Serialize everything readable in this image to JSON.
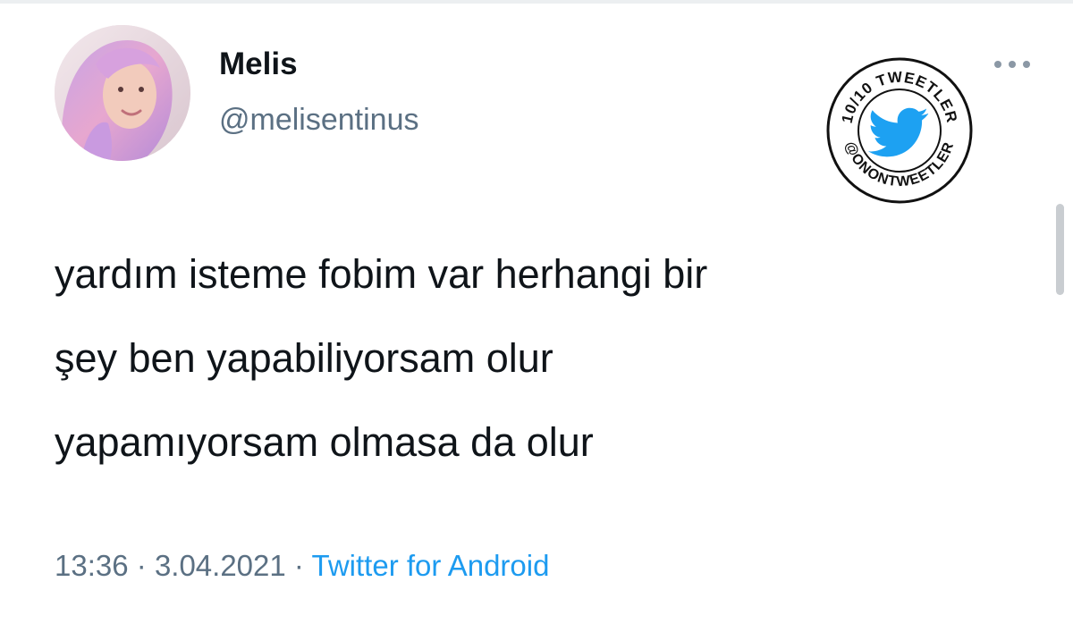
{
  "tweet": {
    "author": {
      "display_name": "Melis",
      "handle": "@melisentinus"
    },
    "text_lines": [
      "yardım isteme fobim var herhangi bir",
      "şey ben yapabiliyorsam olur",
      "yapamıyorsam olmasa da olur"
    ],
    "time": "13:36",
    "separator": "·",
    "date": "3.04.2021",
    "source": "Twitter for Android"
  },
  "watermark": {
    "text_top": "10/10 TWEETLER",
    "text_bottom": "@ONONTWEETLER",
    "bird_color": "#1da1f2"
  },
  "icons": {
    "more": "more-horizontal-icon",
    "avatar": "profile-photo"
  },
  "colors": {
    "name": "#0f1419",
    "secondary": "#5b7083",
    "link": "#1d9bf0"
  }
}
